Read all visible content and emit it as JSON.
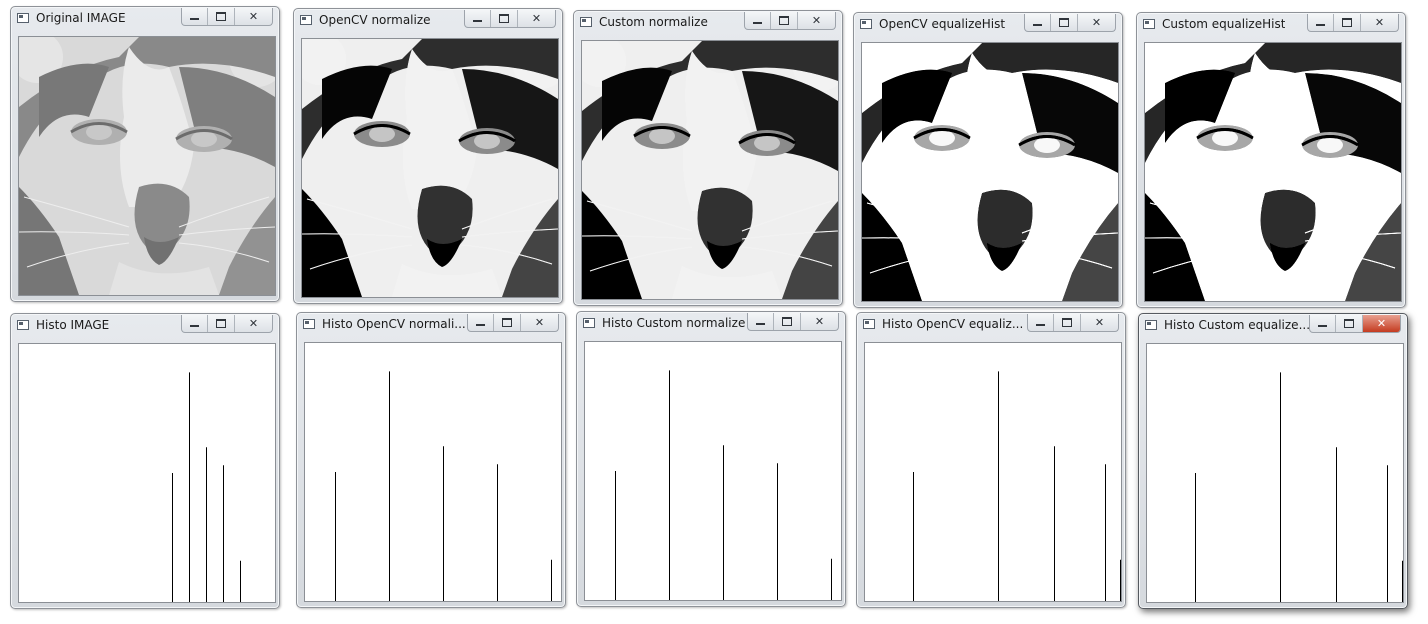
{
  "windows": [
    {
      "id": "original-image",
      "title": "Original IMAGE",
      "min": "▁",
      "max": "□",
      "close": "✕"
    },
    {
      "id": "opencv-normalize",
      "title": "OpenCV normalize",
      "min": "▁",
      "max": "□",
      "close": "✕"
    },
    {
      "id": "custom-normalize",
      "title": "Custom normalize",
      "min": "▁",
      "max": "□",
      "close": "✕"
    },
    {
      "id": "opencv-equalizehist",
      "title": "OpenCV equalizeHist",
      "min": "▁",
      "max": "□",
      "close": "✕"
    },
    {
      "id": "custom-equalizehist",
      "title": "Custom equalizeHist",
      "min": "▁",
      "max": "□",
      "close": "✕"
    },
    {
      "id": "histo-image",
      "title": "Histo IMAGE",
      "min": "▁",
      "max": "□",
      "close": "✕"
    },
    {
      "id": "histo-opencv-normalize",
      "title": "Histo OpenCV normali...",
      "min": "▁",
      "max": "□",
      "close": "✕"
    },
    {
      "id": "histo-custom-normalize",
      "title": "Histo Custom normalize",
      "min": "▁",
      "max": "□",
      "close": "✕"
    },
    {
      "id": "histo-opencv-equalize",
      "title": "Histo OpenCV equaliz...",
      "min": "▁",
      "max": "□",
      "close": "✕"
    },
    {
      "id": "histo-custom-equalize",
      "title": "Histo Custom equalize...",
      "min": "▁",
      "max": "□",
      "close": "✕"
    }
  ],
  "colors": {
    "window_frame": "#d5d9de",
    "close_active": "#c43b20",
    "histogram_bar": "#000000",
    "original_tint": "#b8b8b8"
  },
  "chart_data": [
    {
      "type": "bar",
      "window": "Histo IMAGE",
      "x": [
        153,
        170,
        187,
        204,
        221
      ],
      "values": [
        0.5,
        0.89,
        0.6,
        0.53,
        0.16
      ],
      "xlim": [
        0,
        255
      ],
      "ylim": [
        0,
        1
      ]
    },
    {
      "type": "bar",
      "window": "Histo OpenCV normali...",
      "x": [
        30,
        84,
        138,
        192,
        246
      ],
      "values": [
        0.5,
        0.89,
        0.6,
        0.53,
        0.16
      ],
      "xlim": [
        0,
        255
      ],
      "ylim": [
        0,
        1
      ]
    },
    {
      "type": "bar",
      "window": "Histo Custom normalize",
      "x": [
        30,
        84,
        138,
        192,
        246
      ],
      "values": [
        0.5,
        0.89,
        0.6,
        0.53,
        0.16
      ],
      "xlim": [
        0,
        255
      ],
      "ylim": [
        0,
        1
      ]
    },
    {
      "type": "bar",
      "window": "Histo OpenCV equaliz...",
      "x": [
        48,
        133,
        189,
        240,
        255
      ],
      "values": [
        0.5,
        0.89,
        0.6,
        0.53,
        0.16
      ],
      "xlim": [
        0,
        255
      ],
      "ylim": [
        0,
        1
      ]
    },
    {
      "type": "bar",
      "window": "Histo Custom equalize...",
      "x": [
        48,
        133,
        189,
        240,
        255
      ],
      "values": [
        0.5,
        0.89,
        0.6,
        0.53,
        0.16
      ],
      "xlim": [
        0,
        255
      ],
      "ylim": [
        0,
        1
      ]
    }
  ]
}
